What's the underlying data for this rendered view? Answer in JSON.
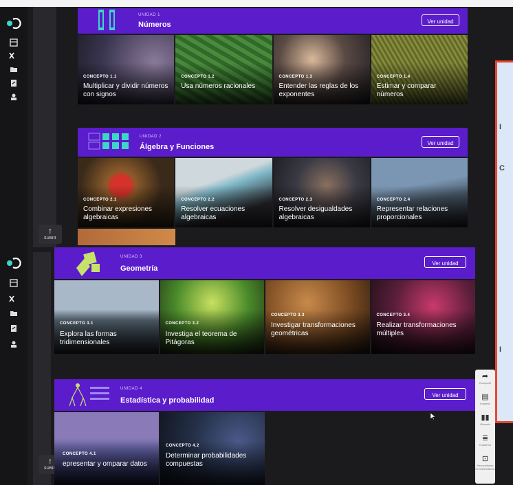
{
  "subir_label": "SUBIR",
  "units": [
    {
      "eyebrow": "UNIDAD 1",
      "title": "Números",
      "button": "Ver unidad",
      "concepts": [
        {
          "eyebrow": "CONCEPTO 1.1",
          "title": "Multiplicar y dividir números con signos"
        },
        {
          "eyebrow": "CONCEPTO 1.2",
          "title": "Usa números racionales"
        },
        {
          "eyebrow": "CONCEPTO 1.3",
          "title": "Entender las reglas de los exponentes"
        },
        {
          "eyebrow": "CONCEPTO 1.4",
          "title": "Estimar y comparar números"
        }
      ]
    },
    {
      "eyebrow": "UNIDAD 2",
      "title": "Álgebra y Funciones",
      "button": "Ver unidad",
      "concepts": [
        {
          "eyebrow": "CONCEPTO 2.1",
          "title": "Combinar expresiones algebraicas"
        },
        {
          "eyebrow": "CONCEPTO 2.2",
          "title": "Resolver ecuaciones algebraicas"
        },
        {
          "eyebrow": "CONCEPTO 2.3",
          "title": "Resolver desigualdades algebraicas"
        },
        {
          "eyebrow": "CONCEPTO 2.4",
          "title": "Representar relaciones proporcionales"
        }
      ]
    },
    {
      "eyebrow": "UNIDAD 3",
      "title": "Geometría",
      "button": "Ver unidad",
      "concepts": [
        {
          "eyebrow": "CONCEPTO 3.1",
          "title": "Explora las formas tridimensionales"
        },
        {
          "eyebrow": "CONCEPTO 3.2",
          "title": "Investiga el teorema de Pitágoras"
        },
        {
          "eyebrow": "CONCEPTO 3.3",
          "title": "Investigar transformaciones geométricas"
        },
        {
          "eyebrow": "CONCEPTO 3.4",
          "title": "Realizar transformaciones múltiples"
        }
      ]
    },
    {
      "eyebrow": "UNIDAD 4",
      "title": "Estadística y probabilidad",
      "button": "Ver unidad",
      "concepts": [
        {
          "eyebrow": "CONCEPTO 4.1",
          "title": "epresentar y omparar datos"
        },
        {
          "eyebrow": "CONCEPTO 4.2",
          "title": "Determinar probabilidades compuestas"
        }
      ]
    }
  ],
  "panel_chars": [
    "I",
    "C",
    "I"
  ],
  "tools": [
    {
      "icon": "share-icon",
      "label": "Compartir"
    },
    {
      "icon": "print-icon",
      "label": "Imprimir"
    },
    {
      "icon": "glossary-icon",
      "label": "Glosario"
    },
    {
      "icon": "notebook-icon",
      "label": "Cuaderno"
    },
    {
      "icon": "toolkit-icon",
      "label": "Herramientas de matemáticas"
    }
  ],
  "colors": {
    "unit_header": "#5b1ccc",
    "panel_border": "#e8472f",
    "panel_bg": "#dce8f8"
  }
}
